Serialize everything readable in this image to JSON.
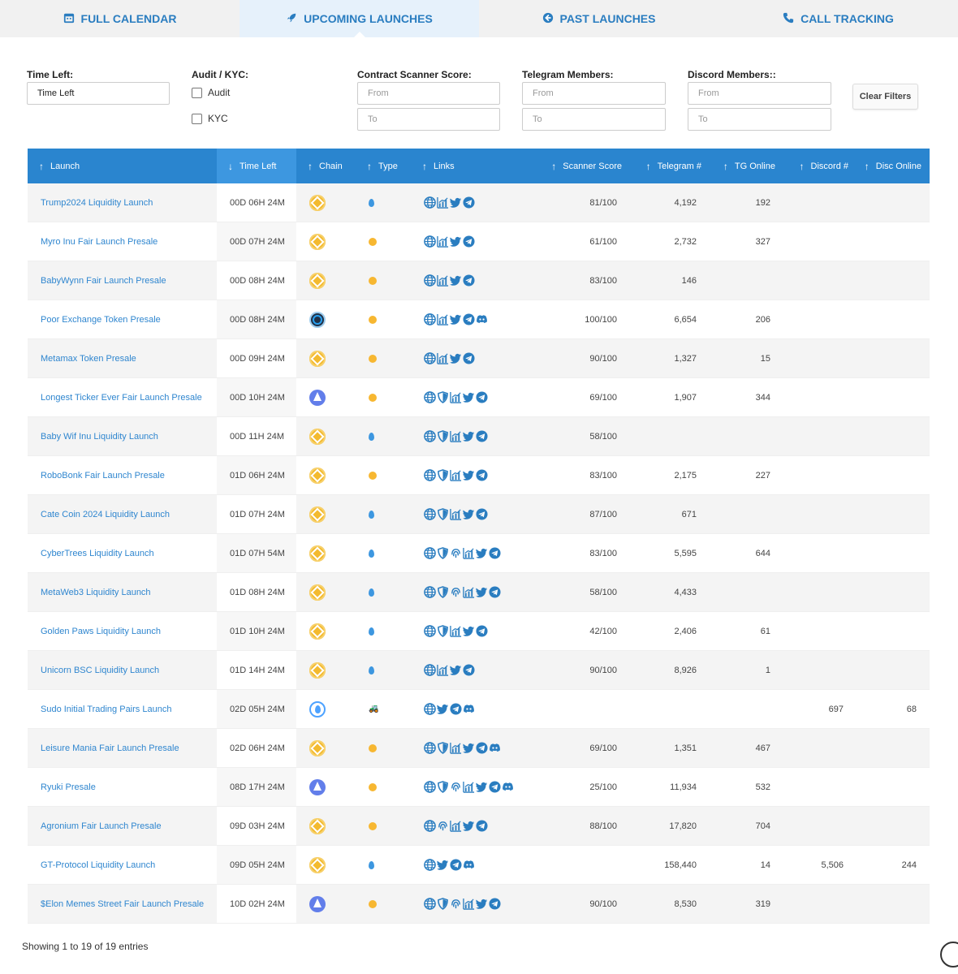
{
  "tabs": [
    {
      "label": "FULL CALENDAR",
      "icon": "calendar-icon"
    },
    {
      "label": "UPCOMING LAUNCHES",
      "icon": "rocket-icon"
    },
    {
      "label": "PAST LAUNCHES",
      "icon": "back-arrow-icon"
    },
    {
      "label": "CALL TRACKING",
      "icon": "phone-icon"
    }
  ],
  "filters": {
    "time_left": {
      "label": "Time Left:",
      "value": "Time Left"
    },
    "audit": {
      "label": "Audit / KYC:",
      "audit_label": "Audit",
      "kyc_label": "KYC"
    },
    "scanner": {
      "label": "Contract Scanner Score:",
      "from": "From",
      "to": "To"
    },
    "telegram": {
      "label": "Telegram Members:",
      "from": "From",
      "to": "To"
    },
    "discord": {
      "label": "Discord Members::",
      "from": "From",
      "to": "To"
    },
    "clear_label": "Clear Filters"
  },
  "table": {
    "columns": [
      "Launch",
      "Time Left",
      "Chain",
      "Type",
      "Links",
      "Scanner Score",
      "Telegram #",
      "TG Online",
      "Discord #",
      "Disc Online"
    ],
    "rows": [
      {
        "name": "Trump2024 Liquidity Launch",
        "time": "00D 06H 24M",
        "chain": "bsc",
        "type": "liquidity",
        "links": [
          "web",
          "chart",
          "twitter",
          "telegram"
        ],
        "score": "81/100",
        "tg": "4,192",
        "tgo": "192",
        "dc": "",
        "dco": ""
      },
      {
        "name": "Myro Inu Fair Launch Presale",
        "time": "00D 07H 24M",
        "chain": "bsc",
        "type": "presale",
        "links": [
          "web",
          "chart",
          "twitter",
          "telegram"
        ],
        "score": "61/100",
        "tg": "2,732",
        "tgo": "327",
        "dc": "",
        "dco": ""
      },
      {
        "name": "BabyWynn Fair Launch Presale",
        "time": "00D 08H 24M",
        "chain": "bsc",
        "type": "presale",
        "links": [
          "web",
          "chart",
          "twitter",
          "telegram"
        ],
        "score": "83/100",
        "tg": "146",
        "tgo": "",
        "dc": "",
        "dco": ""
      },
      {
        "name": "Poor Exchange Token Presale",
        "time": "00D 08H 24M",
        "chain": "arb",
        "type": "presale",
        "links": [
          "web",
          "chart",
          "twitter",
          "telegram",
          "discord"
        ],
        "score": "100/100",
        "tg": "6,654",
        "tgo": "206",
        "dc": "",
        "dco": ""
      },
      {
        "name": "Metamax Token Presale",
        "time": "00D 09H 24M",
        "chain": "bsc",
        "type": "presale",
        "links": [
          "web",
          "chart",
          "twitter",
          "telegram"
        ],
        "score": "90/100",
        "tg": "1,327",
        "tgo": "15",
        "dc": "",
        "dco": ""
      },
      {
        "name": "Longest Ticker Ever Fair Launch Presale",
        "time": "00D 10H 24M",
        "chain": "eth",
        "type": "presale",
        "links": [
          "web",
          "shield",
          "chart",
          "twitter",
          "telegram"
        ],
        "score": "69/100",
        "tg": "1,907",
        "tgo": "344",
        "dc": "",
        "dco": ""
      },
      {
        "name": "Baby Wif Inu Liquidity Launch",
        "time": "00D 11H 24M",
        "chain": "bsc",
        "type": "liquidity",
        "links": [
          "web",
          "shield",
          "chart",
          "twitter",
          "telegram"
        ],
        "score": "58/100",
        "tg": "",
        "tgo": "",
        "dc": "",
        "dco": ""
      },
      {
        "name": "RoboBonk Fair Launch Presale",
        "time": "01D 06H 24M",
        "chain": "bsc",
        "type": "presale",
        "links": [
          "web",
          "shield",
          "chart",
          "twitter",
          "telegram"
        ],
        "score": "83/100",
        "tg": "2,175",
        "tgo": "227",
        "dc": "",
        "dco": ""
      },
      {
        "name": "Cate Coin 2024 Liquidity Launch",
        "time": "01D 07H 24M",
        "chain": "bsc",
        "type": "liquidity",
        "links": [
          "web",
          "shield",
          "chart",
          "twitter",
          "telegram"
        ],
        "score": "87/100",
        "tg": "671",
        "tgo": "",
        "dc": "",
        "dco": ""
      },
      {
        "name": "CyberTrees Liquidity Launch",
        "time": "01D 07H 54M",
        "chain": "bsc",
        "type": "liquidity",
        "links": [
          "web",
          "shield",
          "fingerprint",
          "chart",
          "twitter",
          "telegram"
        ],
        "score": "83/100",
        "tg": "5,595",
        "tgo": "644",
        "dc": "",
        "dco": ""
      },
      {
        "name": "MetaWeb3 Liquidity Launch",
        "time": "01D 08H 24M",
        "chain": "bsc",
        "type": "liquidity",
        "links": [
          "web",
          "shield",
          "fingerprint",
          "chart",
          "twitter",
          "telegram"
        ],
        "score": "58/100",
        "tg": "4,433",
        "tgo": "",
        "dc": "",
        "dco": ""
      },
      {
        "name": "Golden Paws Liquidity Launch",
        "time": "01D 10H 24M",
        "chain": "bsc",
        "type": "liquidity",
        "links": [
          "web",
          "shield",
          "chart",
          "twitter",
          "telegram"
        ],
        "score": "42/100",
        "tg": "2,406",
        "tgo": "61",
        "dc": "",
        "dco": ""
      },
      {
        "name": "Unicorn BSC Liquidity Launch",
        "time": "01D 14H 24M",
        "chain": "bsc",
        "type": "liquidity",
        "links": [
          "web",
          "chart",
          "twitter",
          "telegram"
        ],
        "score": "90/100",
        "tg": "8,926",
        "tgo": "1",
        "dc": "",
        "dco": ""
      },
      {
        "name": "Sudo Initial Trading Pairs Launch",
        "time": "02D 05H 24M",
        "chain": "sui",
        "type": "tractor",
        "links": [
          "web",
          "twitter",
          "telegram",
          "discord"
        ],
        "score": "",
        "tg": "",
        "tgo": "",
        "dc": "697",
        "dco": "68"
      },
      {
        "name": "Leisure Mania Fair Launch Presale",
        "time": "02D 06H 24M",
        "chain": "bsc",
        "type": "presale",
        "links": [
          "web",
          "shield",
          "chart",
          "twitter",
          "telegram",
          "discord"
        ],
        "score": "69/100",
        "tg": "1,351",
        "tgo": "467",
        "dc": "",
        "dco": ""
      },
      {
        "name": "Ryuki Presale",
        "time": "08D 17H 24M",
        "chain": "eth",
        "type": "presale",
        "links": [
          "web",
          "shield",
          "fingerprint",
          "chart",
          "twitter",
          "telegram",
          "discord"
        ],
        "score": "25/100",
        "tg": "11,934",
        "tgo": "532",
        "dc": "",
        "dco": ""
      },
      {
        "name": "Agronium Fair Launch Presale",
        "time": "09D 03H 24M",
        "chain": "bsc",
        "type": "presale",
        "links": [
          "web",
          "fingerprint",
          "chart",
          "twitter",
          "telegram"
        ],
        "score": "88/100",
        "tg": "17,820",
        "tgo": "704",
        "dc": "",
        "dco": ""
      },
      {
        "name": "GT-Protocol Liquidity Launch",
        "time": "09D 05H 24M",
        "chain": "bsc",
        "type": "liquidity",
        "links": [
          "web",
          "twitter",
          "telegram",
          "discord"
        ],
        "score": "",
        "tg": "158,440",
        "tgo": "14",
        "dc": "5,506",
        "dco": "244"
      },
      {
        "name": "$Elon Memes Street Fair Launch Presale",
        "time": "10D 02H 24M",
        "chain": "eth",
        "type": "presale",
        "links": [
          "web",
          "shield",
          "fingerprint",
          "chart",
          "twitter",
          "telegram"
        ],
        "score": "90/100",
        "tg": "8,530",
        "tgo": "319",
        "dc": "",
        "dco": ""
      }
    ]
  },
  "footer": {
    "entries": "Showing 1 to 19 of 19 entries"
  },
  "colors": {
    "accent": "#2a85cf",
    "link": "#2f86cf",
    "bsc": "#f3ba2f",
    "eth": "#627eea"
  }
}
